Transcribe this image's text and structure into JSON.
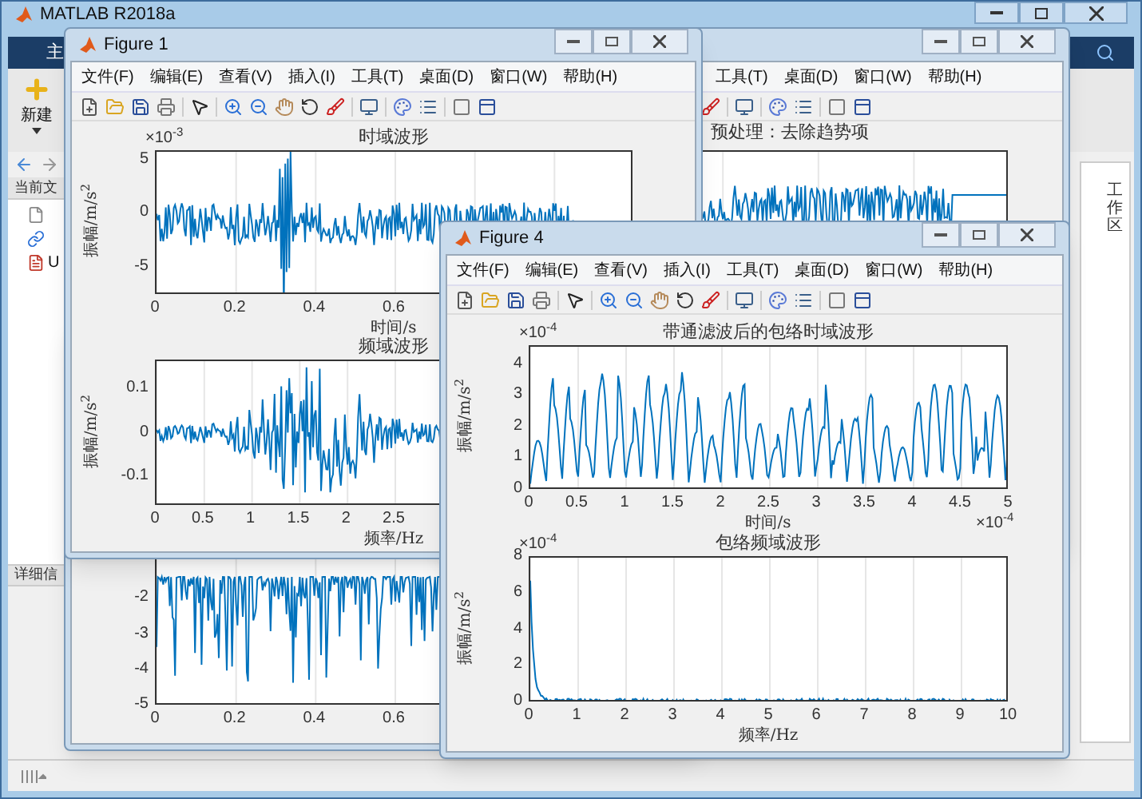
{
  "main_window": {
    "title": "MATLAB R2018a",
    "tab": "主",
    "new_button": "新建",
    "folder_header": "当前文",
    "files": [
      {
        "kind": "page"
      },
      {
        "kind": "link"
      },
      {
        "kind": "document",
        "name": "U"
      }
    ],
    "details_header": "详细信",
    "workspace_label": "工作区"
  },
  "figures": [
    {
      "plots": [
        {
          "kind": "negspikes",
          "yticks": [
            "-2",
            "-3",
            "-4",
            "-5"
          ],
          "xticks": [
            "0",
            "0.2",
            "0.4",
            "0.6"
          ]
        }
      ]
    },
    {
      "menu": [
        "工具(T)",
        "桌面(D)",
        "窗口(W)",
        "帮助(H)"
      ],
      "caption": "预处理：去除趋势项",
      "plots": [
        {
          "kind": "noise2"
        }
      ]
    },
    {
      "title": "Figure 1",
      "menu": [
        "文件(F)",
        "编辑(E)",
        "查看(V)",
        "插入(I)",
        "工具(T)",
        "桌面(D)",
        "窗口(W)",
        "帮助(H)"
      ],
      "plots": [
        {
          "title": "时域波形",
          "kind": "noise",
          "exponent": "×10$^{-3}$",
          "ylabel": "振幅/m/s$^{2}$",
          "yticks": [
            "5",
            "0",
            "-5"
          ],
          "xticks": [
            "0",
            "0.2",
            "0.4",
            "0.6"
          ],
          "xlabel": "时间/s"
        },
        {
          "title": "频域波形",
          "kind": "burst",
          "ylabel": "振幅/m/s$^{2}$",
          "yticks": [
            "0.1",
            "0",
            "-0.1"
          ],
          "xticks": [
            "0",
            "0.5",
            "1",
            "1.5",
            "2",
            "2.5"
          ],
          "xlabel": "频率/Hz"
        }
      ]
    },
    {
      "title": "Figure 4",
      "menu": [
        "文件(F)",
        "编辑(E)",
        "查看(V)",
        "插入(I)",
        "工具(T)",
        "桌面(D)",
        "窗口(W)",
        "帮助(H)"
      ],
      "plots": [
        {
          "title": "带通滤波后的包络时域波形",
          "kind": "envelope",
          "exponent": "×10$^{-4}$",
          "ylabel": "振幅/m/s$^{2}$",
          "yticks": [
            "4",
            "3",
            "2",
            "1",
            "0"
          ],
          "xticks": [
            "0",
            "0.5",
            "1",
            "1.5",
            "2",
            "2.5",
            "3",
            "3.5",
            "4",
            "4.5",
            "5"
          ],
          "xlabel": "时间/s",
          "x_exponent": "×10$^{-4}$"
        },
        {
          "title": "包络频域波形",
          "kind": "decay",
          "exponent": "×10$^{-4}$",
          "ylabel": "振幅/m/s$^{2}$",
          "yticks": [
            "8",
            "6",
            "4",
            "2",
            "0"
          ],
          "xticks": [
            "0",
            "1",
            "2",
            "3",
            "4",
            "5",
            "6",
            "7",
            "8",
            "9",
            "10"
          ],
          "xlabel": "频率/Hz"
        }
      ]
    }
  ]
}
